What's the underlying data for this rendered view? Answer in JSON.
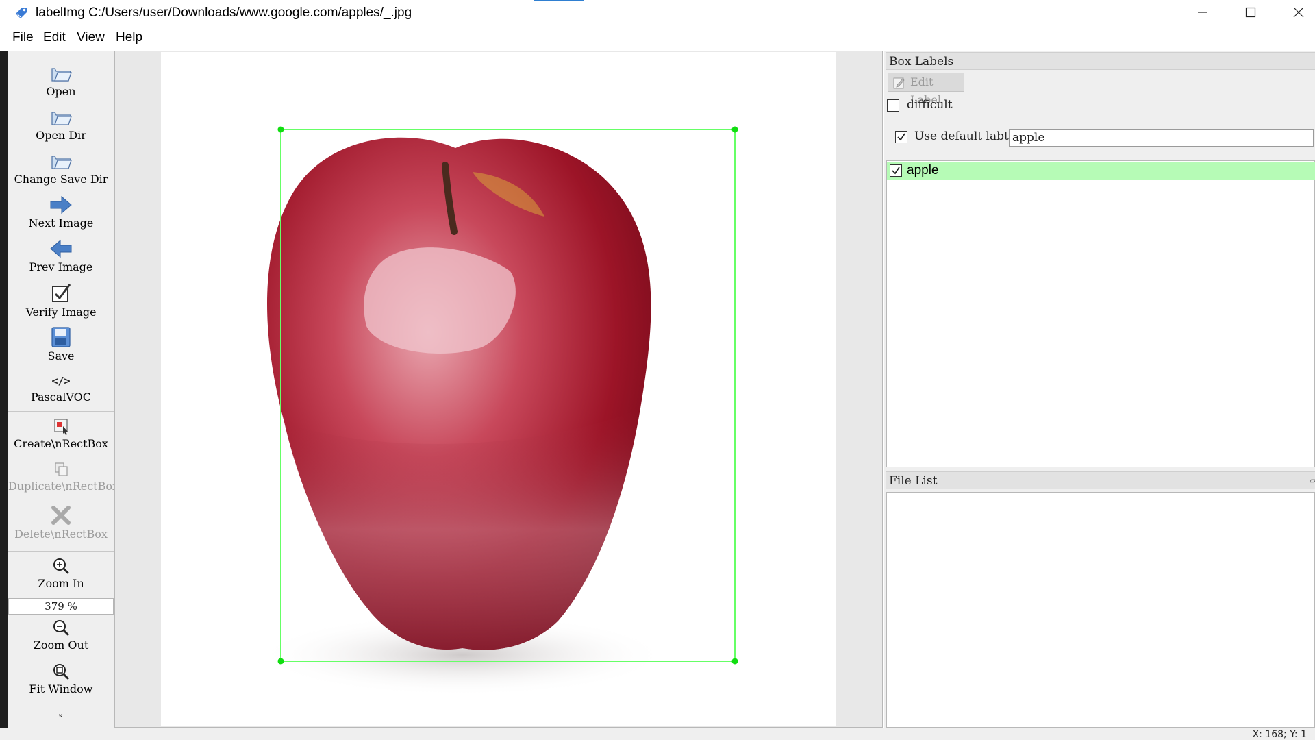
{
  "window": {
    "title": "labelImg C:/Users/user/Downloads/www.google.com/apples/_.jpg",
    "controls": [
      "minimize-icon",
      "maximize-icon",
      "close-icon"
    ]
  },
  "menu": [
    {
      "label": "File",
      "mnemonic": "F",
      "rest": "ile"
    },
    {
      "label": "Edit",
      "mnemonic": "E",
      "rest": "dit"
    },
    {
      "label": "View",
      "mnemonic": "V",
      "rest": "iew"
    },
    {
      "label": "Help",
      "mnemonic": "H",
      "rest": "elp"
    }
  ],
  "toolbar": {
    "open": "Open",
    "open_dir": "Open Dir",
    "change_save_dir": "Change Save Dir",
    "next_image": "Next Image",
    "prev_image": "Prev Image",
    "verify_image": "Verify Image",
    "save": "Save",
    "format": "PascalVOC",
    "create_rectbox": "Create\\nRectBox",
    "duplicate_rectbox": "Duplicate\\nRectBox",
    "delete_rectbox": "Delete\\nRectBox",
    "zoom_in": "Zoom In",
    "zoom_value": "379 %",
    "zoom_out": "Zoom Out",
    "fit_window": "Fit Window",
    "more": "»"
  },
  "box_labels": {
    "title": "Box Labels",
    "edit_label": "Edit Label",
    "difficult": "difficult",
    "difficult_checked": false,
    "use_default_label": "Use default labtel",
    "use_default_checked": true,
    "default_label_value": "apple",
    "labels": [
      {
        "text": "apple",
        "checked": true,
        "highlight": "#b6fbb6"
      }
    ]
  },
  "file_list": {
    "title": "File List",
    "items": []
  },
  "canvas": {
    "box_color": "#66ff66",
    "image_subject": "red apple"
  },
  "status": {
    "coords": "X: 168; Y: 1"
  },
  "colors": {
    "accent": "#2f7fd1",
    "toolbar_bg": "#efefef",
    "selected_label": "#b6fbb6"
  }
}
